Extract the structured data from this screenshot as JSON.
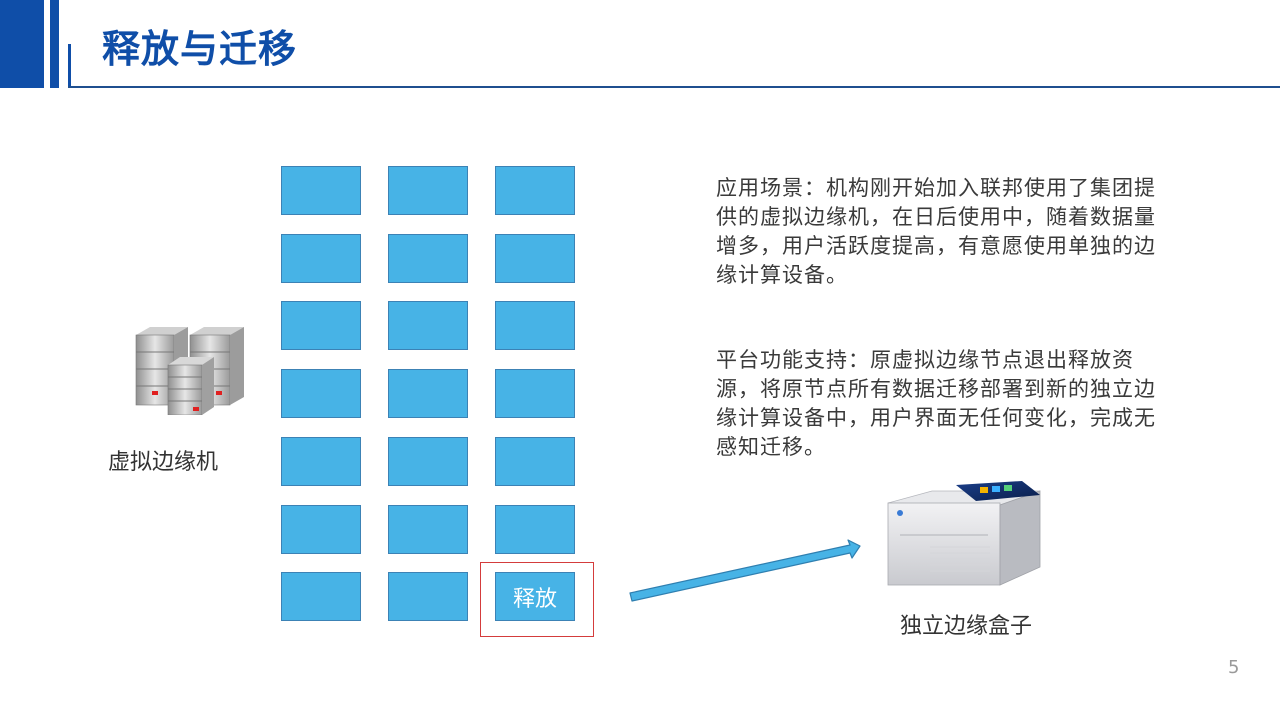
{
  "header": {
    "title": "释放与迁移"
  },
  "grid": {
    "rows": 7,
    "cols": 3,
    "highlight_label": "释放"
  },
  "server": {
    "label": "虚拟边缘机",
    "icon": "server-cluster-icon"
  },
  "description": {
    "scenario": "应用场景：机构刚开始加入联邦使用了集团提供的虚拟边缘机，在日后使用中，随着数据量增多，用户活跃度提高，有意愿使用单独的边缘计算设备。",
    "platform": "平台功能支持：原虚拟边缘节点退出释放资源，将原节点所有数据迁移部署到新的独立边缘计算设备中，用户界面无任何变化，完成无感知迁移。"
  },
  "device": {
    "label": "独立边缘盒子",
    "icon": "edge-box-device-icon"
  },
  "page": {
    "number": "5"
  },
  "colors": {
    "brand": "#0f4ea8",
    "cell": "#47b3e6",
    "highlight": "#d43c3c"
  }
}
